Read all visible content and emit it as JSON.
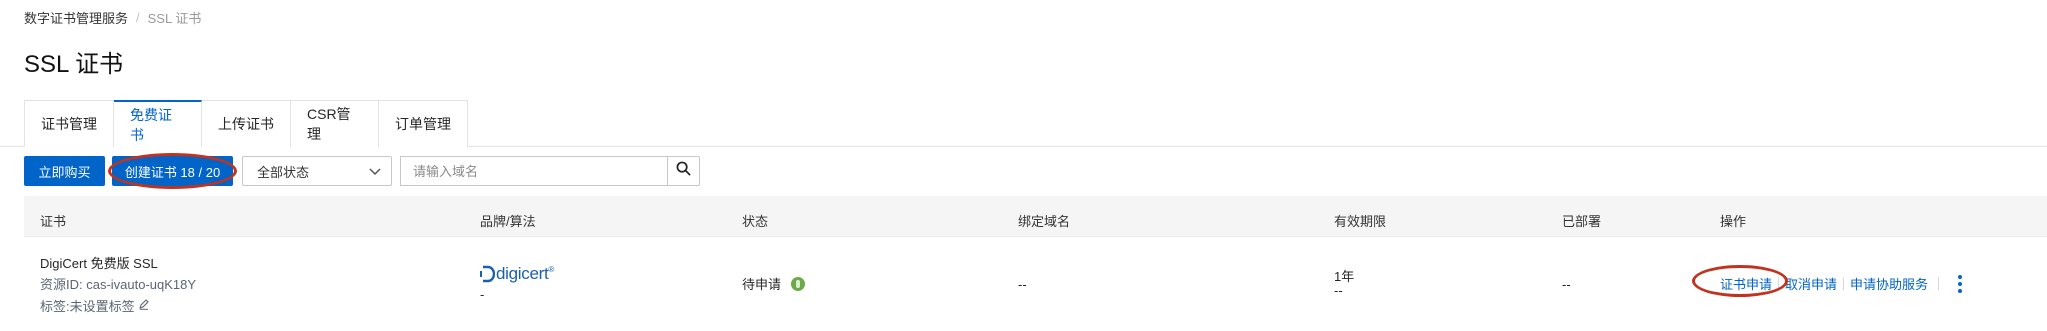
{
  "breadcrumb": {
    "root": "数字证书管理服务",
    "separator": "/",
    "current": "SSL 证书"
  },
  "page_title": "SSL 证书",
  "tabs": [
    {
      "label": "证书管理",
      "active": false
    },
    {
      "label": "免费证书",
      "active": true
    },
    {
      "label": "上传证书",
      "active": false
    },
    {
      "label": "CSR管理",
      "active": false
    },
    {
      "label": "订单管理",
      "active": false
    }
  ],
  "toolbar": {
    "buy_label": "立即购买",
    "create_label": "创建证书 18 / 20",
    "status_select_value": "全部状态",
    "search_placeholder": "请输入域名"
  },
  "table": {
    "columns": [
      "证书",
      "品牌/算法",
      "状态",
      "绑定域名",
      "有效期限",
      "已部署",
      "操作"
    ],
    "rows": [
      {
        "cert_name": "DigiCert 免费版 SSL",
        "resource_id": "资源ID: cas-ivauto-uqK18Y",
        "tag": "标签:未设置标签",
        "brand": "digicert",
        "algorithm": "-",
        "status": "待申请",
        "bound_domain": "--",
        "validity": "1年",
        "validity_sub": "--",
        "deployed": "--",
        "actions": [
          "证书申请",
          "取消申请",
          "申请协助服务"
        ]
      }
    ]
  },
  "colors": {
    "primary": "#0064c8",
    "annotation": "#c2331f",
    "status_icon": "#6caa4a",
    "digicert_brand": "#1b5fb0"
  },
  "icons": [
    "search-icon",
    "chevron-down-icon",
    "edit-icon",
    "status-pending-icon",
    "more-vertical-icon"
  ]
}
